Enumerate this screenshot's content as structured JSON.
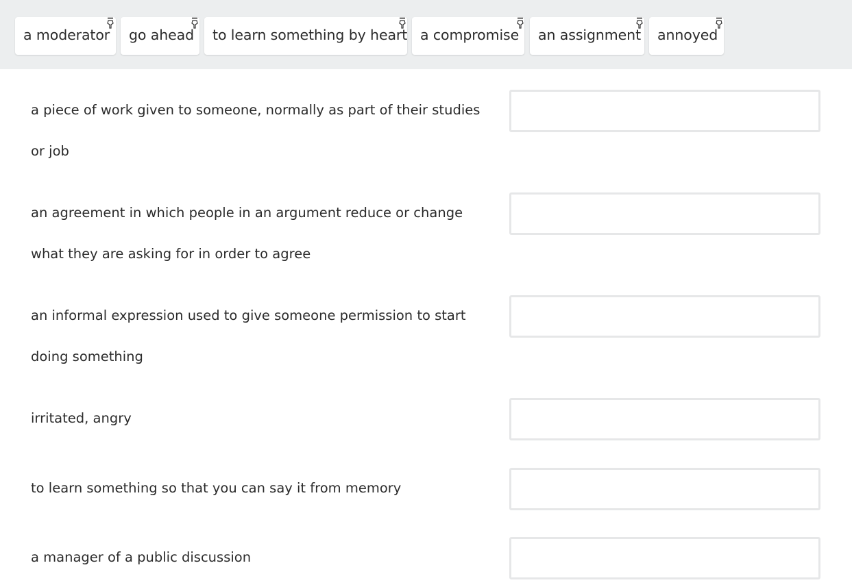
{
  "word_bank": {
    "chips": [
      {
        "label": "a moderator",
        "icon": "drag-pin-icon"
      },
      {
        "label": "go ahead",
        "icon": "drag-pin-icon"
      },
      {
        "label": "to learn something by heart",
        "icon": "drag-pin-icon"
      },
      {
        "label": "a compromise",
        "icon": "drag-pin-icon"
      },
      {
        "label": "an assignment",
        "icon": "drag-pin-icon"
      },
      {
        "label": "annoyed",
        "icon": "drag-pin-icon"
      }
    ]
  },
  "definitions": [
    {
      "line1": "a piece of work given to someone, normally as part of their studies",
      "line2": "or job",
      "answer": ""
    },
    {
      "line1": "an agreement in which people in an argument reduce or change",
      "line2": "what they are asking for in order to agree",
      "answer": ""
    },
    {
      "line1": "an informal expression used to give someone permission to start",
      "line2": "doing something",
      "answer": ""
    },
    {
      "line1": "irritated, angry",
      "line2": "",
      "answer": ""
    },
    {
      "line1": "to learn something so that you can say it from memory",
      "line2": "",
      "answer": ""
    },
    {
      "line1": "a manager of a public discussion",
      "line2": "",
      "answer": ""
    }
  ]
}
